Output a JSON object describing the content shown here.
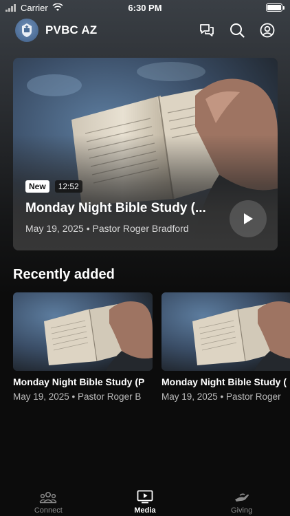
{
  "status_bar": {
    "carrier": "Carrier",
    "time": "6:30 PM"
  },
  "header": {
    "app_name": "PVBC AZ"
  },
  "hero": {
    "badge_new": "New",
    "duration": "12:52",
    "title": "Monday Night Bible Study (...",
    "meta": "May 19, 2025 • Pastor Roger Bradford"
  },
  "recently_added": {
    "title": "Recently added",
    "items": [
      {
        "title": "Monday Night Bible Study (P",
        "meta": "May 19, 2025 • Pastor Roger B"
      },
      {
        "title": "Monday Night Bible Study (",
        "meta": "May 19, 2025 • Pastor Roger"
      }
    ]
  },
  "tabs": [
    {
      "label": "Connect",
      "icon": "people-icon",
      "active": false
    },
    {
      "label": "Media",
      "icon": "play-screen-icon",
      "active": true
    },
    {
      "label": "Giving",
      "icon": "giving-hand-icon",
      "active": false
    }
  ]
}
